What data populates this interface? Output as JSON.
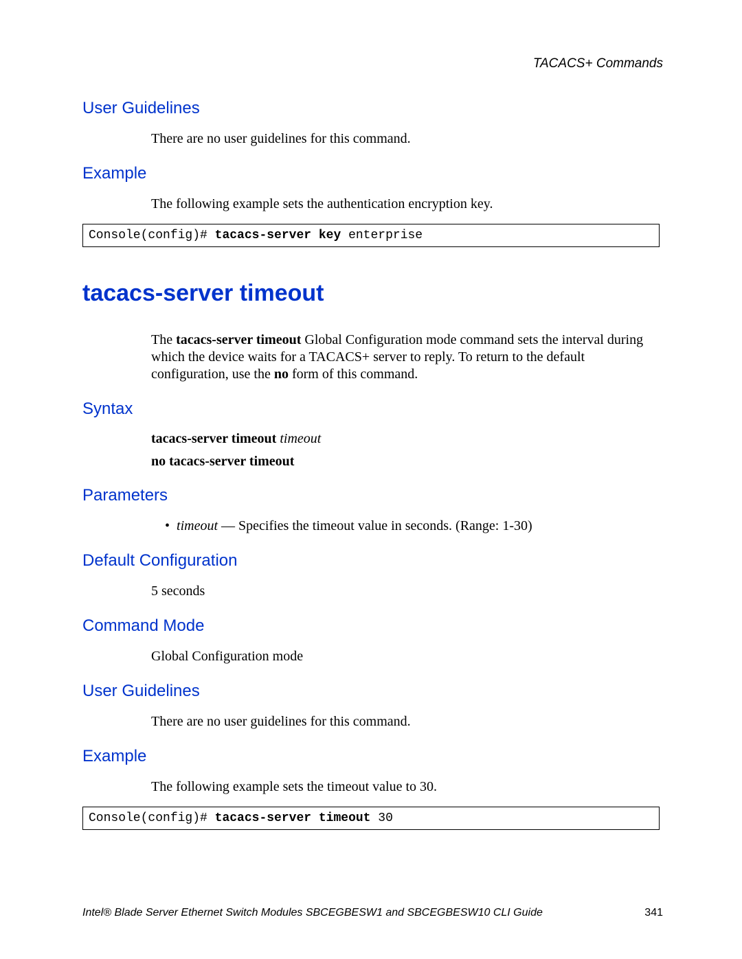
{
  "header": {
    "right": "TACACS+ Commands"
  },
  "sections": {
    "ug1": {
      "title": "User Guidelines",
      "text": "There are no user guidelines for this command."
    },
    "ex1": {
      "title": "Example",
      "text": "The following example sets the authentication encryption key.",
      "code_prefix": "Console(config)# ",
      "code_bold": "tacacs-server key",
      "code_suffix": " enterprise"
    },
    "cmd": {
      "title": "tacacs-server timeout",
      "desc_pre": "The ",
      "desc_bold": "tacacs-server timeout",
      "desc_post": " Global Configuration mode command sets the interval during which the device waits for a TACACS+ server to reply. To return to the default configuration, use the ",
      "desc_bold2": "no",
      "desc_post2": " form of this command."
    },
    "syntax": {
      "title": "Syntax",
      "line1_bold": "tacacs-server timeout ",
      "line1_ital": "timeout",
      "line2_bold": "no tacacs-server timeout"
    },
    "params": {
      "title": "Parameters",
      "bullet_ital": "timeout",
      "bullet_rest": " — Specifies the timeout value in seconds. (Range: 1-30)"
    },
    "defcfg": {
      "title": "Default Configuration",
      "text": "5 seconds"
    },
    "cmdmode": {
      "title": "Command Mode",
      "text": "Global Configuration mode"
    },
    "ug2": {
      "title": "User Guidelines",
      "text": "There are no user guidelines for this command."
    },
    "ex2": {
      "title": "Example",
      "text": "The following example sets the timeout value to 30.",
      "code_prefix": "Console(config)# ",
      "code_bold": "tacacs-server timeout",
      "code_suffix": " 30"
    }
  },
  "footer": {
    "text": "Intel® Blade Server Ethernet Switch Modules SBCEGBESW1 and SBCEGBESW10 CLI Guide",
    "page": "341"
  }
}
